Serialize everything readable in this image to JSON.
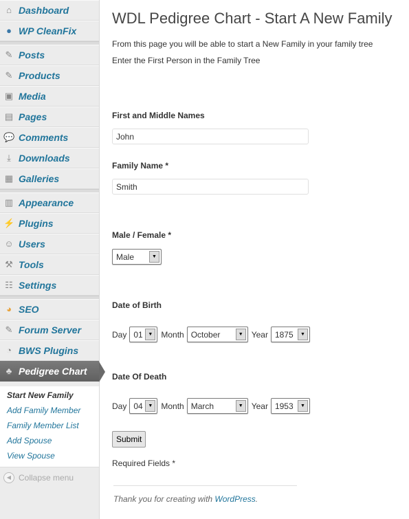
{
  "sidebar": {
    "items": [
      {
        "label": "Dashboard",
        "icon": "home-icon"
      },
      {
        "label": "WP CleanFix",
        "icon": "cleanfix-icon"
      },
      {
        "label": "Posts",
        "icon": "pin-icon"
      },
      {
        "label": "Products",
        "icon": "pin-icon"
      },
      {
        "label": "Media",
        "icon": "media-icon"
      },
      {
        "label": "Pages",
        "icon": "pages-icon"
      },
      {
        "label": "Comments",
        "icon": "comment-icon"
      },
      {
        "label": "Downloads",
        "icon": "download-icon"
      },
      {
        "label": "Galleries",
        "icon": "gallery-icon"
      },
      {
        "label": "Appearance",
        "icon": "appearance-icon"
      },
      {
        "label": "Plugins",
        "icon": "plugin-icon"
      },
      {
        "label": "Users",
        "icon": "users-icon"
      },
      {
        "label": "Tools",
        "icon": "tools-icon"
      },
      {
        "label": "Settings",
        "icon": "settings-icon"
      },
      {
        "label": "SEO",
        "icon": "seo-icon"
      },
      {
        "label": "Forum Server",
        "icon": "pencil-icon"
      },
      {
        "label": "BWS Plugins",
        "icon": "bws-icon"
      },
      {
        "label": "Pedigree Chart",
        "icon": "tree-icon",
        "active": true
      }
    ],
    "submenu": [
      "Start New Family",
      "Add Family Member",
      "Family Member List",
      "Add Spouse",
      "View Spouse"
    ],
    "collapse": "Collapse menu"
  },
  "main": {
    "title": "WDL Pedigree Chart - Start A New Family",
    "intro": "From this page you will be able to start a New Family in your family tree",
    "subintro": "Enter the First Person in the Family Tree",
    "first_label": "First and Middle Names",
    "first_value": "John",
    "family_label": "Family Name *",
    "family_value": "Smith",
    "gender_label": "Male / Female *",
    "gender_value": "Male",
    "dob_label": "Date of Birth",
    "dod_label": "Date Of Death",
    "day_label": "Day",
    "month_label": "Month",
    "year_label": "Year",
    "dob": {
      "day": "01",
      "month": "October",
      "year": "1875"
    },
    "dod": {
      "day": "04",
      "month": "March",
      "year": "1953"
    },
    "submit": "Submit",
    "required": "Required Fields *"
  },
  "footer": {
    "text": "Thank you for creating with ",
    "link": "WordPress",
    "end": "."
  },
  "colors": {
    "link": "#21759b",
    "active_menu": "#6a6a6a"
  }
}
